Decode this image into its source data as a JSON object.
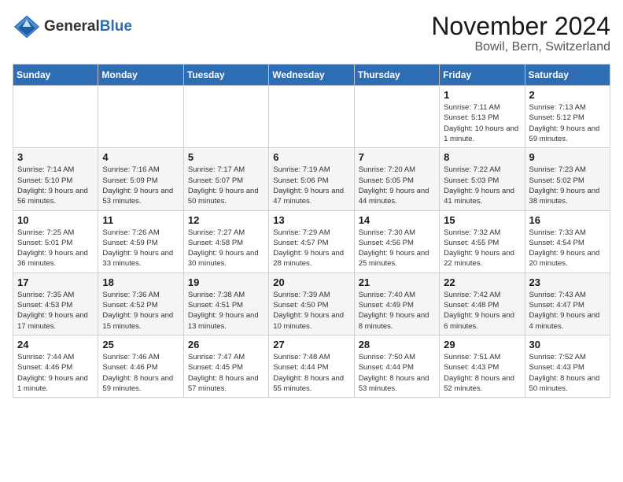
{
  "header": {
    "logo_general": "General",
    "logo_blue": "Blue",
    "month_title": "November 2024",
    "location": "Bowil, Bern, Switzerland"
  },
  "weekdays": [
    "Sunday",
    "Monday",
    "Tuesday",
    "Wednesday",
    "Thursday",
    "Friday",
    "Saturday"
  ],
  "weeks": [
    [
      {
        "day": "",
        "info": ""
      },
      {
        "day": "",
        "info": ""
      },
      {
        "day": "",
        "info": ""
      },
      {
        "day": "",
        "info": ""
      },
      {
        "day": "",
        "info": ""
      },
      {
        "day": "1",
        "info": "Sunrise: 7:11 AM\nSunset: 5:13 PM\nDaylight: 10 hours and 1 minute."
      },
      {
        "day": "2",
        "info": "Sunrise: 7:13 AM\nSunset: 5:12 PM\nDaylight: 9 hours and 59 minutes."
      }
    ],
    [
      {
        "day": "3",
        "info": "Sunrise: 7:14 AM\nSunset: 5:10 PM\nDaylight: 9 hours and 56 minutes."
      },
      {
        "day": "4",
        "info": "Sunrise: 7:16 AM\nSunset: 5:09 PM\nDaylight: 9 hours and 53 minutes."
      },
      {
        "day": "5",
        "info": "Sunrise: 7:17 AM\nSunset: 5:07 PM\nDaylight: 9 hours and 50 minutes."
      },
      {
        "day": "6",
        "info": "Sunrise: 7:19 AM\nSunset: 5:06 PM\nDaylight: 9 hours and 47 minutes."
      },
      {
        "day": "7",
        "info": "Sunrise: 7:20 AM\nSunset: 5:05 PM\nDaylight: 9 hours and 44 minutes."
      },
      {
        "day": "8",
        "info": "Sunrise: 7:22 AM\nSunset: 5:03 PM\nDaylight: 9 hours and 41 minutes."
      },
      {
        "day": "9",
        "info": "Sunrise: 7:23 AM\nSunset: 5:02 PM\nDaylight: 9 hours and 38 minutes."
      }
    ],
    [
      {
        "day": "10",
        "info": "Sunrise: 7:25 AM\nSunset: 5:01 PM\nDaylight: 9 hours and 36 minutes."
      },
      {
        "day": "11",
        "info": "Sunrise: 7:26 AM\nSunset: 4:59 PM\nDaylight: 9 hours and 33 minutes."
      },
      {
        "day": "12",
        "info": "Sunrise: 7:27 AM\nSunset: 4:58 PM\nDaylight: 9 hours and 30 minutes."
      },
      {
        "day": "13",
        "info": "Sunrise: 7:29 AM\nSunset: 4:57 PM\nDaylight: 9 hours and 28 minutes."
      },
      {
        "day": "14",
        "info": "Sunrise: 7:30 AM\nSunset: 4:56 PM\nDaylight: 9 hours and 25 minutes."
      },
      {
        "day": "15",
        "info": "Sunrise: 7:32 AM\nSunset: 4:55 PM\nDaylight: 9 hours and 22 minutes."
      },
      {
        "day": "16",
        "info": "Sunrise: 7:33 AM\nSunset: 4:54 PM\nDaylight: 9 hours and 20 minutes."
      }
    ],
    [
      {
        "day": "17",
        "info": "Sunrise: 7:35 AM\nSunset: 4:53 PM\nDaylight: 9 hours and 17 minutes."
      },
      {
        "day": "18",
        "info": "Sunrise: 7:36 AM\nSunset: 4:52 PM\nDaylight: 9 hours and 15 minutes."
      },
      {
        "day": "19",
        "info": "Sunrise: 7:38 AM\nSunset: 4:51 PM\nDaylight: 9 hours and 13 minutes."
      },
      {
        "day": "20",
        "info": "Sunrise: 7:39 AM\nSunset: 4:50 PM\nDaylight: 9 hours and 10 minutes."
      },
      {
        "day": "21",
        "info": "Sunrise: 7:40 AM\nSunset: 4:49 PM\nDaylight: 9 hours and 8 minutes."
      },
      {
        "day": "22",
        "info": "Sunrise: 7:42 AM\nSunset: 4:48 PM\nDaylight: 9 hours and 6 minutes."
      },
      {
        "day": "23",
        "info": "Sunrise: 7:43 AM\nSunset: 4:47 PM\nDaylight: 9 hours and 4 minutes."
      }
    ],
    [
      {
        "day": "24",
        "info": "Sunrise: 7:44 AM\nSunset: 4:46 PM\nDaylight: 9 hours and 1 minute."
      },
      {
        "day": "25",
        "info": "Sunrise: 7:46 AM\nSunset: 4:46 PM\nDaylight: 8 hours and 59 minutes."
      },
      {
        "day": "26",
        "info": "Sunrise: 7:47 AM\nSunset: 4:45 PM\nDaylight: 8 hours and 57 minutes."
      },
      {
        "day": "27",
        "info": "Sunrise: 7:48 AM\nSunset: 4:44 PM\nDaylight: 8 hours and 55 minutes."
      },
      {
        "day": "28",
        "info": "Sunrise: 7:50 AM\nSunset: 4:44 PM\nDaylight: 8 hours and 53 minutes."
      },
      {
        "day": "29",
        "info": "Sunrise: 7:51 AM\nSunset: 4:43 PM\nDaylight: 8 hours and 52 minutes."
      },
      {
        "day": "30",
        "info": "Sunrise: 7:52 AM\nSunset: 4:43 PM\nDaylight: 8 hours and 50 minutes."
      }
    ]
  ]
}
